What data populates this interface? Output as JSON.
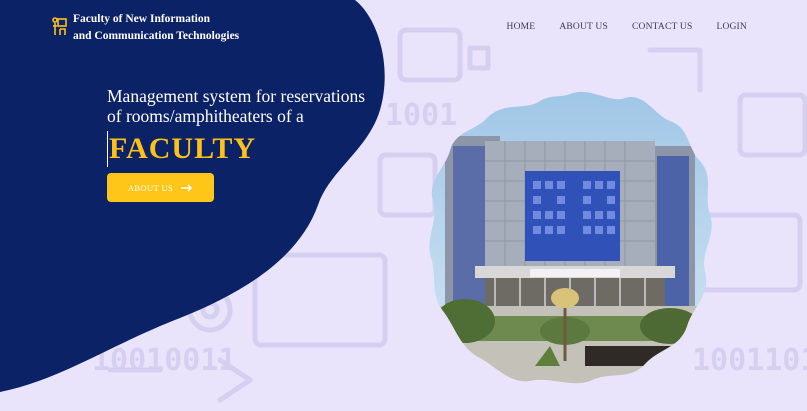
{
  "header": {
    "logo_icon": "classroom-icon",
    "logo_line1": "Faculty of New Information",
    "logo_line2": "and Communication Technologies"
  },
  "nav": {
    "items": [
      {
        "label": "HOME"
      },
      {
        "label": "ABOUT US"
      },
      {
        "label": "CONTACT US"
      },
      {
        "label": "LOGIN"
      }
    ]
  },
  "hero": {
    "line1": "Management system for reservations",
    "line2": "of rooms/amphitheaters of a",
    "highlight": "FACULTY",
    "button_label": "ABOUT US",
    "button_icon": "arrow-right-icon"
  },
  "colors": {
    "background": "#e9e4fb",
    "blob": "#0c2266",
    "accent": "#ffc61a",
    "highlight_text": "#ffc21a"
  }
}
